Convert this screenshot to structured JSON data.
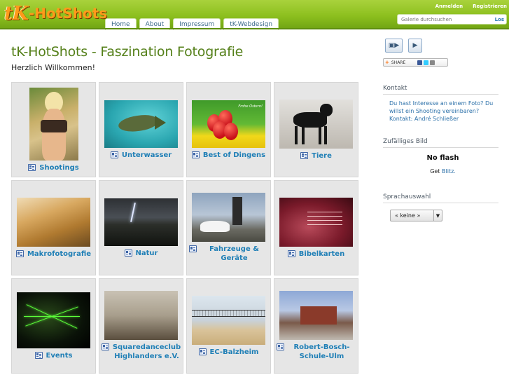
{
  "header": {
    "logo_tk": "tK",
    "logo_rest": "-HotShots",
    "nav": [
      "Home",
      "About",
      "Impressum",
      "tK-Webdesign"
    ],
    "links": [
      "Anmelden",
      "Registrieren"
    ],
    "search": {
      "placeholder": "Galerie durchsuchen",
      "button": "Los"
    }
  },
  "main": {
    "title": "tK-HotShots - Faszination Fotografie",
    "subtitle": "Herzlich Willkommen!",
    "albums": [
      {
        "label": "Shootings",
        "thumb": "shootings"
      },
      {
        "label": "Unterwasser",
        "thumb": "unterwasser"
      },
      {
        "label": "Best of Dingens",
        "thumb": "dingens",
        "thumb_text": "Frohe Ostern!"
      },
      {
        "label": "Tiere",
        "thumb": "tiere"
      },
      {
        "label": "Makrofotografie",
        "thumb": "makro"
      },
      {
        "label": "Natur",
        "thumb": "natur"
      },
      {
        "label": "Fahrzeuge & Geräte",
        "thumb": "fahrzeuge"
      },
      {
        "label": "Bibelkarten",
        "thumb": "bibel"
      },
      {
        "label": "Events",
        "thumb": "events"
      },
      {
        "label": "Squaredanceclub Highlanders e.V.",
        "thumb": "square"
      },
      {
        "label": "EC-Balzheim",
        "thumb": "balz"
      },
      {
        "label": "Robert-Bosch-Schule-Ulm",
        "thumb": "bosch"
      }
    ]
  },
  "sidebar": {
    "share_label": "SHARE",
    "kontakt": {
      "heading": "Kontakt",
      "text": "Du hast Interesse an einem Foto? Du willst ein Shooting vereinbaren? Kontakt: André Schließer"
    },
    "zufall": {
      "heading": "Zufälliges Bild",
      "noflash": "No flash",
      "get": "Get",
      "blitz": "Blitz."
    },
    "sprache": {
      "heading": "Sprachauswahl",
      "selected": "« keine »"
    }
  },
  "colors": {
    "header_green": "#8cbf1e",
    "title_green": "#55801a",
    "link_blue": "#1f7fb6",
    "logo_orange": "#ff9a1a"
  }
}
